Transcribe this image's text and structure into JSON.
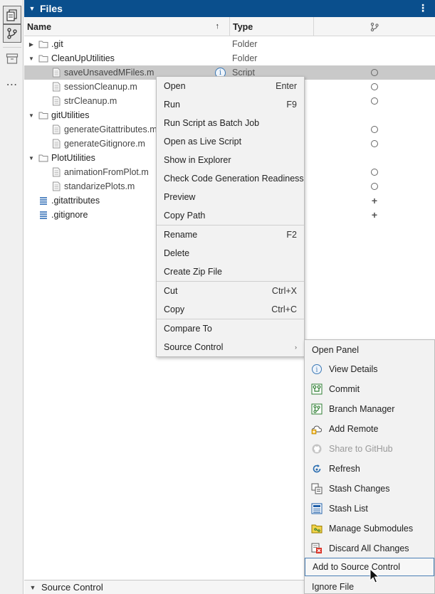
{
  "panel": {
    "title": "Files",
    "menu_glyph": "⋮"
  },
  "columns": {
    "name": "Name",
    "type": "Type",
    "sort_glyph": "↑"
  },
  "tree": [
    {
      "label": ".git",
      "type": "Folder",
      "kind": "folder",
      "expander": "▶",
      "sc": ""
    },
    {
      "label": "CleanUpUtilities",
      "type": "Folder",
      "kind": "folder",
      "expander": "▼",
      "sc": ""
    },
    {
      "label": "saveUnsavedMFiles.m",
      "type": "Script",
      "kind": "script",
      "expander": "",
      "sc": "○",
      "selected": true
    },
    {
      "label": "sessionCleanup.m",
      "type": "",
      "kind": "script",
      "expander": "",
      "sc": "○"
    },
    {
      "label": "strCleanup.m",
      "type": "",
      "kind": "script",
      "expander": "",
      "sc": "○"
    },
    {
      "label": "gitUtilities",
      "type": "",
      "kind": "folder",
      "expander": "▼",
      "sc": ""
    },
    {
      "label": "generateGitattributes.m",
      "type": "",
      "kind": "script",
      "expander": "",
      "sc": "○"
    },
    {
      "label": "generateGitignore.m",
      "type": "",
      "kind": "script",
      "expander": "",
      "sc": "○"
    },
    {
      "label": "PlotUtilities",
      "type": "",
      "kind": "folder",
      "expander": "▼",
      "sc": ""
    },
    {
      "label": "animationFromPlot.m",
      "type": "",
      "kind": "script",
      "expander": "",
      "sc": "○"
    },
    {
      "label": "standarizePlots.m",
      "type": "",
      "kind": "script",
      "expander": "",
      "sc": "○"
    },
    {
      "label": ".gitattributes",
      "type": "",
      "kind": "textfile",
      "expander": "",
      "sc": "+"
    },
    {
      "label": ".gitignore",
      "type": "",
      "kind": "textfile",
      "expander": "",
      "sc": "+"
    }
  ],
  "context_menu": {
    "groups": [
      [
        {
          "label": "Open",
          "shortcut": "Enter"
        },
        {
          "label": "Run",
          "shortcut": "F9"
        },
        {
          "label": "Run Script as Batch Job",
          "shortcut": ""
        },
        {
          "label": "Open as Live Script",
          "shortcut": ""
        },
        {
          "label": "Show in Explorer",
          "shortcut": ""
        },
        {
          "label": "Check Code Generation Readiness",
          "shortcut": ""
        },
        {
          "label": "Preview",
          "shortcut": ""
        },
        {
          "label": "Copy Path",
          "shortcut": ""
        }
      ],
      [
        {
          "label": "Rename",
          "shortcut": "F2"
        },
        {
          "label": "Delete",
          "shortcut": ""
        },
        {
          "label": "Create Zip File",
          "shortcut": ""
        }
      ],
      [
        {
          "label": "Cut",
          "shortcut": "Ctrl+X"
        },
        {
          "label": "Copy",
          "shortcut": "Ctrl+C"
        }
      ],
      [
        {
          "label": "Compare To",
          "shortcut": ""
        },
        {
          "label": "Source Control",
          "shortcut": "",
          "submenu": true
        }
      ]
    ],
    "submenu_arrow": "›"
  },
  "source_control_menu": [
    {
      "label": "Open Panel",
      "icon": "",
      "disabled": false
    },
    {
      "label": "View Details",
      "icon": "info-icon",
      "disabled": false
    },
    {
      "label": "Commit",
      "icon": "commit-icon",
      "disabled": false
    },
    {
      "label": "Branch Manager",
      "icon": "branch-icon",
      "disabled": false
    },
    {
      "label": "Add Remote",
      "icon": "cloud-add-icon",
      "disabled": false
    },
    {
      "label": "Share to GitHub",
      "icon": "github-icon",
      "disabled": true
    },
    {
      "label": "Refresh",
      "icon": "refresh-icon",
      "disabled": false
    },
    {
      "label": "Stash Changes",
      "icon": "stash-changes-icon",
      "disabled": false
    },
    {
      "label": "Stash List",
      "icon": "stash-list-icon",
      "disabled": false
    },
    {
      "label": "Manage Submodules",
      "icon": "submodules-icon",
      "disabled": false
    },
    {
      "label": "Discard All Changes",
      "icon": "discard-icon",
      "disabled": false
    },
    {
      "label": "Add to Source Control",
      "icon": "",
      "disabled": false,
      "hot": true
    },
    {
      "label": "Ignore File",
      "icon": "",
      "disabled": false
    }
  ],
  "bottom_panel": {
    "title": "Source Control"
  },
  "colors": {
    "header_bg": "#0a4f8d",
    "selected_row": "#c9c9c9",
    "menu_bg": "#f2f2f2",
    "hover_border": "#4a7fb5"
  }
}
